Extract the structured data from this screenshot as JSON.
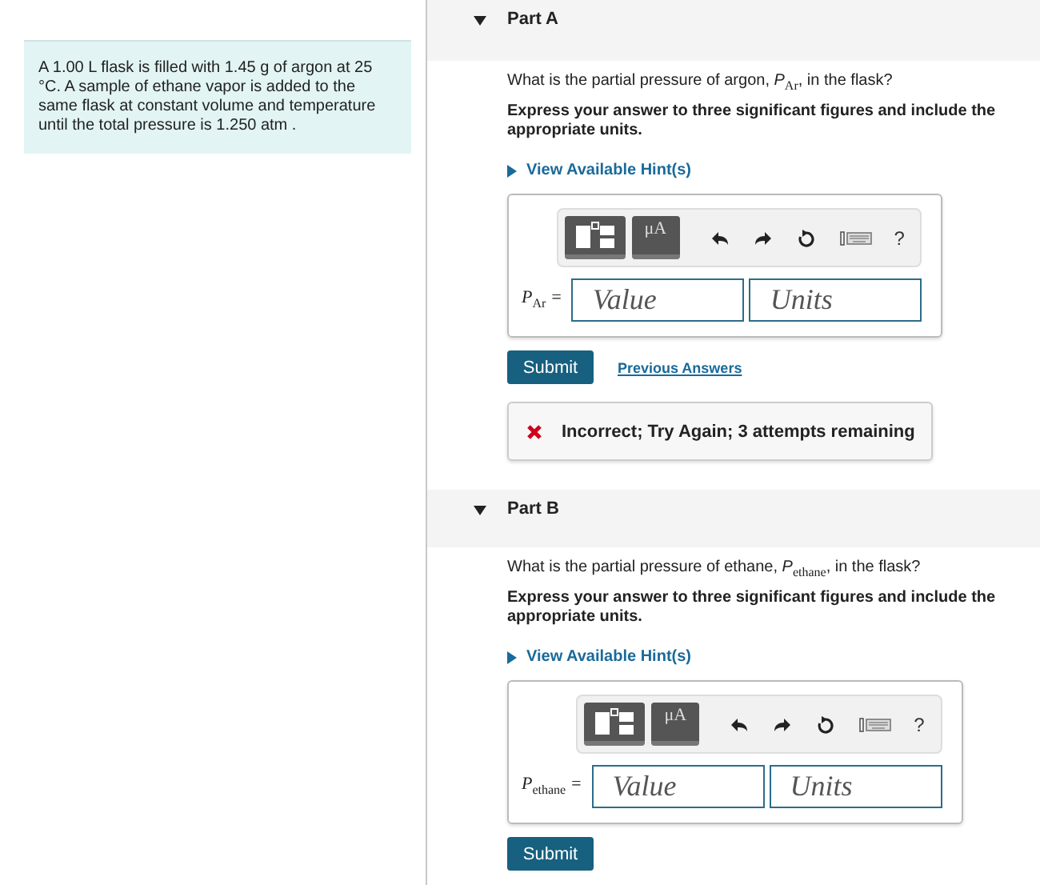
{
  "problem": {
    "text": "A 1.00 L flask is filled with 1.45 g of argon at 25 °C. A sample of ethane vapor is added to the same flask at constant volume and temperature until the total pressure is 1.250 atm ."
  },
  "parts": [
    {
      "title": "Part A",
      "expanded": true,
      "question": "What is the partial pressure of argon, *P*$_{Ar}$, in the flask?",
      "instruction": "Express your answer to three significant figures and include the appropriate units.",
      "hint": {
        "label": "View Available Hint(s)",
        "expanded": false
      },
      "toolbar": {
        "units_button": "μA",
        "help": "?"
      },
      "label": "*P*$_{Ar}$ =",
      "fields": [
        {
          "placeholder": "Value"
        },
        {
          "placeholder": "Units"
        }
      ],
      "submit": "Submit",
      "previous_answers": "Previous Answers",
      "feedback": {
        "kind": "incorrect",
        "text": "Incorrect; Try Again; 3 attempts remaining"
      }
    },
    {
      "title": "Part B",
      "expanded": true,
      "question": "What is the partial pressure of ethane, *P*$_{ethane}$, in the flask?",
      "instruction": "Express your answer to three significant figures and include the appropriate units.",
      "hint": {
        "label": "View Available Hint(s)",
        "expanded": false
      },
      "toolbar": {
        "units_button": "μA",
        "help": "?"
      },
      "label": "*P*$_{ethane}$ =",
      "fields": [
        {
          "placeholder": "Value"
        },
        {
          "placeholder": "Units"
        }
      ],
      "submit": "Submit"
    }
  ]
}
